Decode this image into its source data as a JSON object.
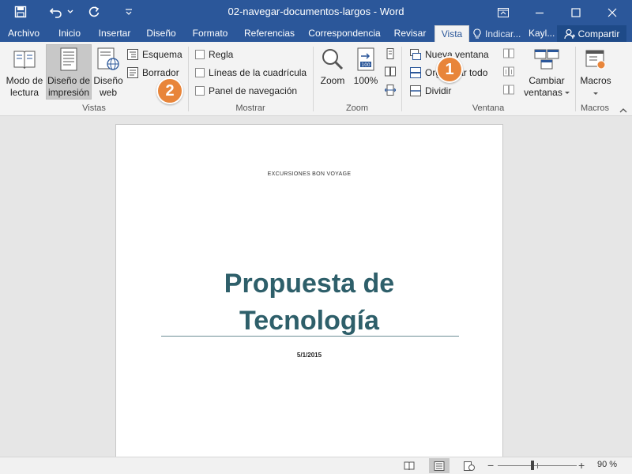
{
  "window": {
    "title": "02-navegar-documentos-largos  -  Word"
  },
  "tabs": [
    "Archivo",
    "Inicio",
    "Insertar",
    "Diseño",
    "Formato",
    "Referencias",
    "Correspondencia",
    "Revisar",
    "Vista"
  ],
  "active_tab": "Vista",
  "tell_me": "Indicar...",
  "user": "Kayl...",
  "share_label": "Compartir",
  "ribbon": {
    "vistas": {
      "label": "Vistas",
      "modo_lectura": [
        "Modo de",
        "lectura"
      ],
      "diseno_impresion": [
        "Diseño de",
        "impresión"
      ],
      "diseno_web": [
        "Diseño",
        "web"
      ],
      "esquema": "Esquema",
      "borrador": "Borrador"
    },
    "mostrar": {
      "label": "Mostrar",
      "regla": "Regla",
      "cuadricula": "Líneas de la cuadrícula",
      "panel_nav": "Panel de navegación"
    },
    "zoom": {
      "label": "Zoom",
      "zoom": "Zoom",
      "pct100": "100%"
    },
    "ventana": {
      "label": "Ventana",
      "nueva": "Nueva ventana",
      "organizar": "Organizar todo",
      "dividir": "Dividir",
      "cambiar": [
        "Cambiar",
        "ventanas"
      ]
    },
    "macros": {
      "label": "Macros",
      "macros": "Macros"
    }
  },
  "callouts": [
    "1",
    "2"
  ],
  "document": {
    "header": "EXCURSIONES BON VOYAGE",
    "title_line1": "Propuesta de",
    "title_line2": "Tecnología",
    "date": "5/1/2015"
  },
  "status": {
    "zoom_pct": "90 %",
    "zoom_minus": "−",
    "zoom_plus": "+"
  }
}
